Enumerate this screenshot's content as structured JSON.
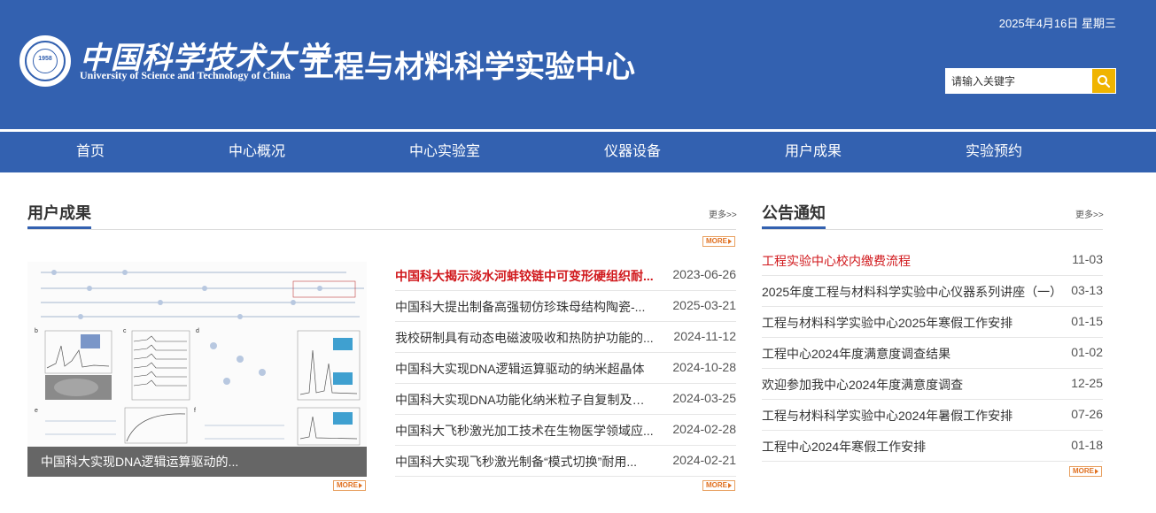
{
  "header": {
    "logo_cn": "中国科学技术大学",
    "logo_en": "University of Science and Technology of China",
    "logo_year": "1958",
    "site_title": "工程与材料科学实验中心",
    "date": "2025年4月16日 星期三",
    "search_placeholder": "请输入关键字",
    "search_icon": "search-icon"
  },
  "nav": {
    "items": [
      {
        "label": "首页"
      },
      {
        "label": "中心概况"
      },
      {
        "label": "中心实验室"
      },
      {
        "label": "仪器设备"
      },
      {
        "label": "用户成果"
      },
      {
        "label": "实验预约"
      }
    ]
  },
  "achievements": {
    "title": "用户成果",
    "more_text": "更多>>",
    "more_badge": "MORE",
    "figure_caption": "中国科大实现DNA逻辑运算驱动的...",
    "items": [
      {
        "title": "中国科大揭示淡水河蚌铰链中可变形硬组织耐...",
        "date": "2023-06-26",
        "highlight": true
      },
      {
        "title": "中国科大提出制备高强韧仿珍珠母结构陶瓷-...",
        "date": "2025-03-21",
        "highlight": false
      },
      {
        "title": "我校研制具有动态电磁波吸收和热防护功能的...",
        "date": "2024-11-12",
        "highlight": false
      },
      {
        "title": "中国科大实现DNA逻辑运算驱动的纳米超晶体",
        "date": "2024-10-28",
        "highlight": false
      },
      {
        "title": "中国科大实现DNA功能化纳米粒子自复制及可...",
        "date": "2024-03-25",
        "highlight": false
      },
      {
        "title": "中国科大飞秒激光加工技术在生物医学领域应...",
        "date": "2024-02-28",
        "highlight": false
      },
      {
        "title": "中国科大实现飞秒激光制备“模式切换”耐用...",
        "date": "2024-02-21",
        "highlight": false
      }
    ]
  },
  "notices": {
    "title": "公告通知",
    "more_text": "更多>>",
    "more_badge": "MORE",
    "items": [
      {
        "title": "工程实验中心校内缴费流程",
        "date": "11-03",
        "highlight": true
      },
      {
        "title": "2025年度工程与材料科学实验中心仪器系列讲座（一）",
        "date": "03-13",
        "highlight": false
      },
      {
        "title": "工程与材料科学实验中心2025年寒假工作安排",
        "date": "01-15",
        "highlight": false
      },
      {
        "title": "工程中心2024年度满意度调查结果",
        "date": "01-02",
        "highlight": false
      },
      {
        "title": "欢迎参加我中心2024年度满意度调查",
        "date": "12-25",
        "highlight": false
      },
      {
        "title": "工程与材料科学实验中心2024年暑假工作安排",
        "date": "07-26",
        "highlight": false
      },
      {
        "title": "工程中心2024年寒假工作安排",
        "date": "01-18",
        "highlight": false
      }
    ]
  },
  "colors": {
    "brand_blue": "#3361b0",
    "highlight_red": "#d0171b",
    "search_button": "#f0b400"
  }
}
